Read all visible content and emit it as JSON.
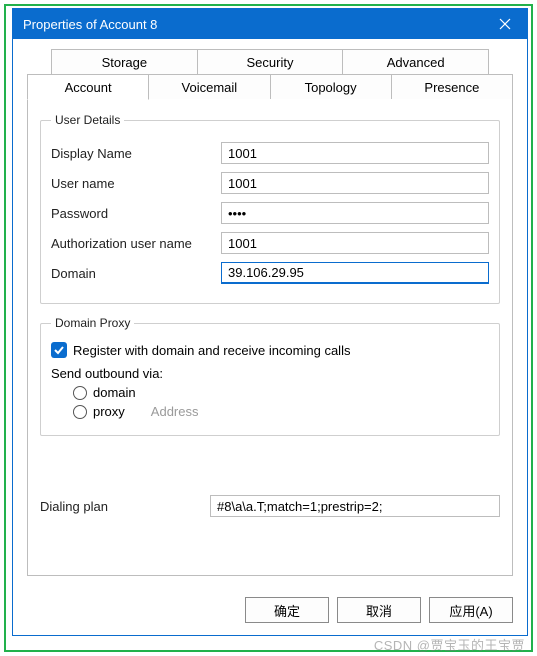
{
  "window": {
    "title": "Properties of Account 8"
  },
  "tabs": {
    "row1": [
      "Storage",
      "Security",
      "Advanced"
    ],
    "row2": [
      "Account",
      "Voicemail",
      "Topology",
      "Presence"
    ],
    "active": "Account"
  },
  "user_details": {
    "legend": "User Details",
    "display_name_label": "Display Name",
    "display_name_value": "1001",
    "user_name_label": "User name",
    "user_name_value": "1001",
    "password_label": "Password",
    "password_value": "••••",
    "auth_user_label": "Authorization user name",
    "auth_user_value": "1001",
    "domain_label": "Domain",
    "domain_value": "39.106.29.95"
  },
  "domain_proxy": {
    "legend": "Domain Proxy",
    "register_label": "Register with domain and receive incoming calls",
    "register_checked": true,
    "send_via_label": "Send outbound via:",
    "opt_domain": "domain",
    "opt_proxy": "proxy",
    "address_placeholder": "Address"
  },
  "dialing_plan": {
    "label": "Dialing plan",
    "value": "#8\\a\\a.T;match=1;prestrip=2;"
  },
  "buttons": {
    "ok": "确定",
    "cancel": "取消",
    "apply": "应用(A)"
  },
  "watermark": "CSDN @贾宝玉的王宝贾"
}
